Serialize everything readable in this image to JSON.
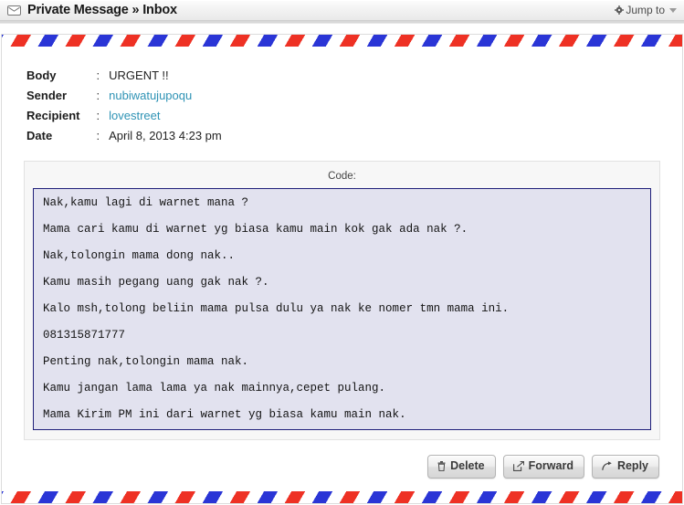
{
  "header": {
    "icon": "envelope-icon",
    "title_main": "Private Message",
    "title_separator": "»",
    "title_section": "Inbox",
    "jump_to_label": "Jump to",
    "jump_to_icon": "gear-icon",
    "caret_icon": "chevron-down-icon"
  },
  "message": {
    "fields": [
      {
        "label": "Body",
        "colon": ":",
        "value": "URGENT !!",
        "is_link": false
      },
      {
        "label": "Sender",
        "colon": ":",
        "value": "nubiwatujupoqu",
        "is_link": true
      },
      {
        "label": "Recipient",
        "colon": ":",
        "value": "lovestreet",
        "is_link": true
      },
      {
        "label": "Date",
        "colon": ":",
        "value": "April 8, 2013 4:23 pm",
        "is_link": false
      }
    ],
    "code_caption": "Code:",
    "code_lines": [
      "Nak,kamu lagi di warnet mana ?",
      "",
      "Mama cari kamu di warnet yg biasa kamu main kok gak ada nak ?.",
      "",
      "Nak,tolongin mama dong nak..",
      "",
      "Kamu masih pegang uang gak nak ?.",
      "",
      "Kalo msh,tolong beliin mama pulsa dulu ya nak ke nomer tmn mama ini.",
      "",
      "081315871777",
      "",
      "Penting nak,tolongin mama nak.",
      "",
      "Kamu jangan lama lama ya nak mainnya,cepet pulang.",
      "",
      "Mama Kirim PM ini dari warnet yg biasa kamu main nak."
    ]
  },
  "actions": [
    {
      "label": "Delete",
      "icon": "trash-icon"
    },
    {
      "label": "Forward",
      "icon": "share-forward-icon"
    },
    {
      "label": "Reply",
      "icon": "reply-arrow-icon"
    }
  ],
  "colors": {
    "link": "#2f93b5",
    "airmail_red": "#ee3124",
    "airmail_blue": "#2a35d6",
    "code_background": "#e2e2ef",
    "code_border": "#20207a"
  }
}
